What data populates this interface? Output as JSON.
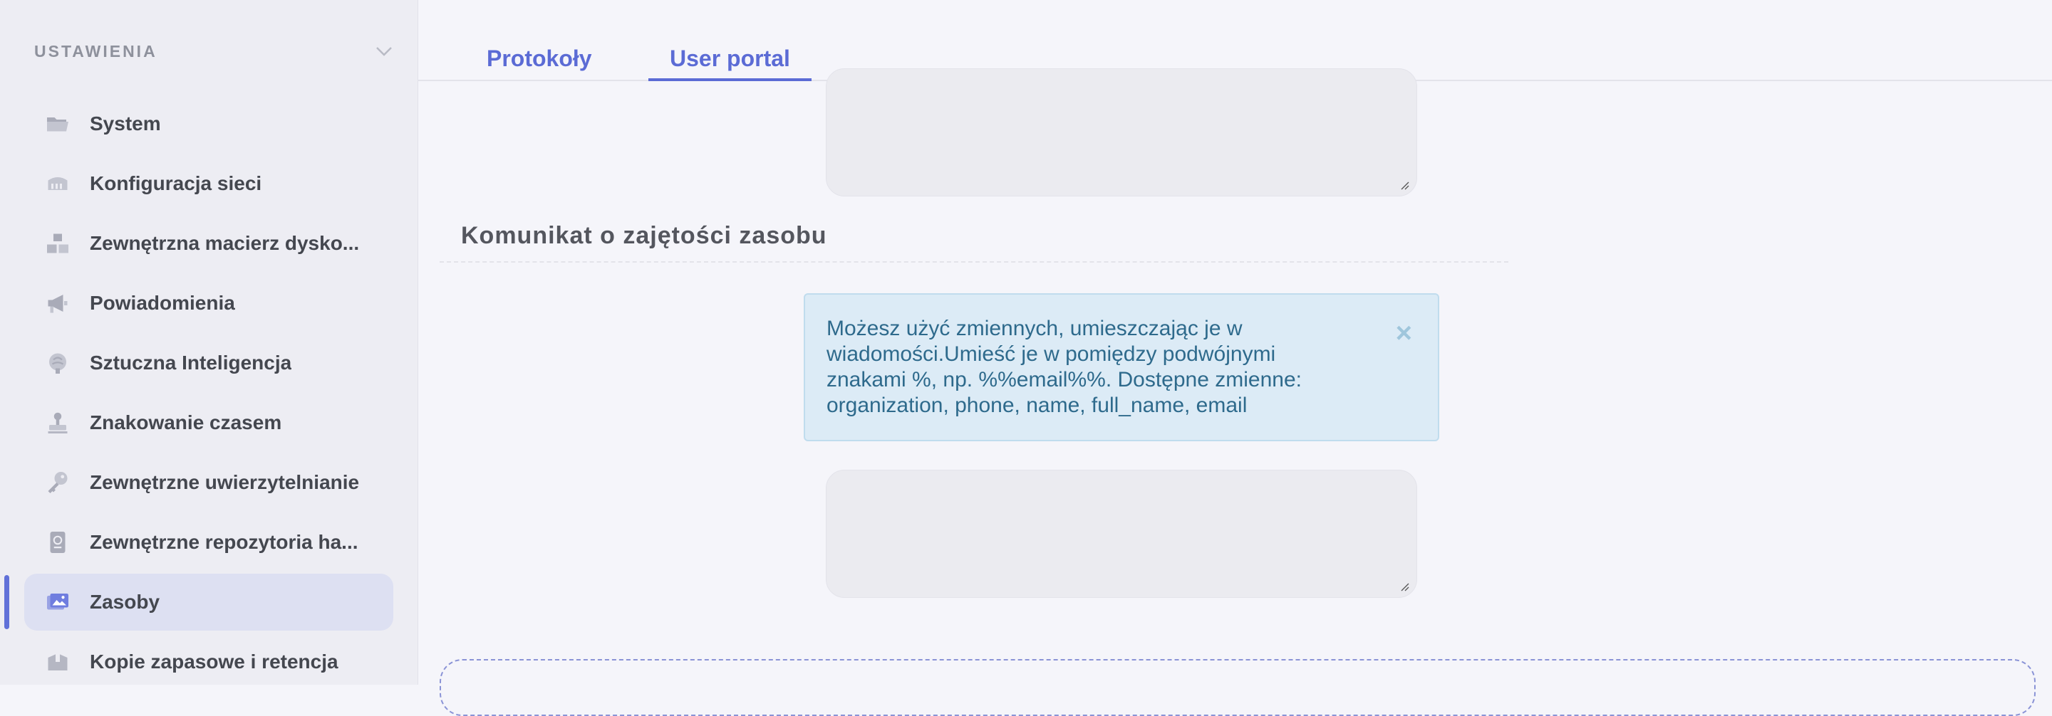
{
  "sidebar": {
    "title": "USTAWIENIA",
    "items": [
      {
        "label": "System",
        "icon": "folder-icon"
      },
      {
        "label": "Konfiguracja sieci",
        "icon": "network-port-icon"
      },
      {
        "label": "Zewnętrzna macierz dysko...",
        "icon": "boxes-icon"
      },
      {
        "label": "Powiadomienia",
        "icon": "megaphone-icon"
      },
      {
        "label": "Sztuczna Inteligencja",
        "icon": "brain-icon"
      },
      {
        "label": "Znakowanie czasem",
        "icon": "stamp-icon"
      },
      {
        "label": "Zewnętrzne uwierzytelnianie",
        "icon": "key-icon"
      },
      {
        "label": "Zewnętrzne repozytoria ha...",
        "icon": "passport-icon"
      },
      {
        "label": "Zasoby",
        "icon": "image-gallery-icon",
        "active": true
      },
      {
        "label": "Kopie zapasowe i retencja",
        "icon": "archive-box-icon"
      }
    ]
  },
  "tabs": [
    {
      "label": "Protokoły",
      "active": false
    },
    {
      "label": "User portal",
      "active": true
    }
  ],
  "section": {
    "title": "Komunikat o zajętości zasobu"
  },
  "alert": {
    "text": "Możesz użyć zmiennych, umieszczając je w wiadomości.Umieść je w pomiędzy podwójnymi znakami %, np. %%email%%. Dostępne zmienne: organization, phone, name, full_name, email",
    "close": "×"
  },
  "colors": {
    "accent": "#5b6bd5",
    "alert_bg": "#dcebf6",
    "alert_text": "#2e6a8c",
    "sidebar_bg": "#ededf3",
    "active_item_bg": "#dde0f2"
  }
}
